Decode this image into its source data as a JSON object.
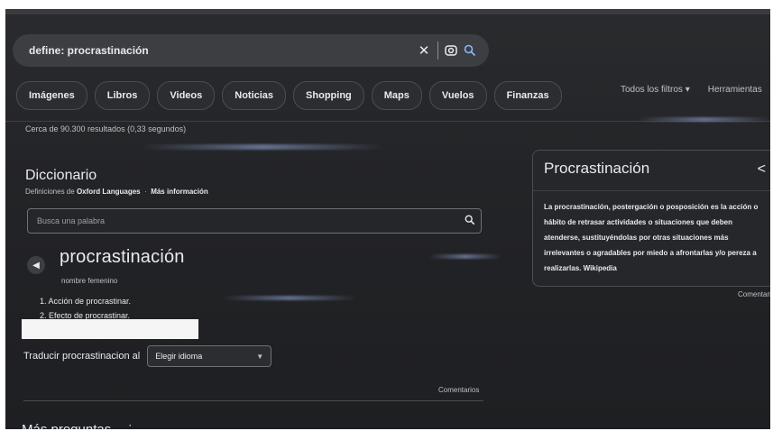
{
  "search": {
    "query": "define: procrastinación",
    "clear_icon": "close-icon",
    "lens_icon": "camera-lens-icon",
    "search_icon": "search-icon"
  },
  "chips": [
    "Imágenes",
    "Libros",
    "Videos",
    "Noticias",
    "Shopping",
    "Maps",
    "Vuelos",
    "Finanzas"
  ],
  "tools": {
    "filters": "Todos los filtros ▾",
    "tools_label": "Herramientas"
  },
  "result_stats": "Cerca de 90.300 resultados (0,33 segundos)",
  "dictionary": {
    "title": "Diccionario",
    "source_prefix": "Definiciones de",
    "source_name": "Oxford Languages",
    "more_info": "Más información",
    "search_placeholder": "Busca una palabra",
    "headword": "procrastinación",
    "part_of_speech": "nombre femenino",
    "definitions": [
      "1. Acción de procrastinar.",
      "2. Efecto de procrastinar."
    ],
    "translate_label": "Traducir procrastinacion al",
    "language_select": "Elegir idioma"
  },
  "comments_label": "Comentarios",
  "more_questions": "Más preguntas",
  "knowledge_panel": {
    "title": "Procrastinación",
    "text": "La procrastinación, postergación o posposición es la acción o hábito de retrasar actividades o situaciones que deben atenderse, sustituyéndolas por otras situaciones más irrelevantes o agradables por miedo a afrontarlas y/o pereza a realizarlas. Wikipedia",
    "comments_label": "Comentarios"
  },
  "colors": {
    "background": "#232427",
    "surface": "#3c3e42",
    "text": "#e8eaed",
    "muted_text": "#bdc1c6",
    "border": "#4b4d52"
  }
}
